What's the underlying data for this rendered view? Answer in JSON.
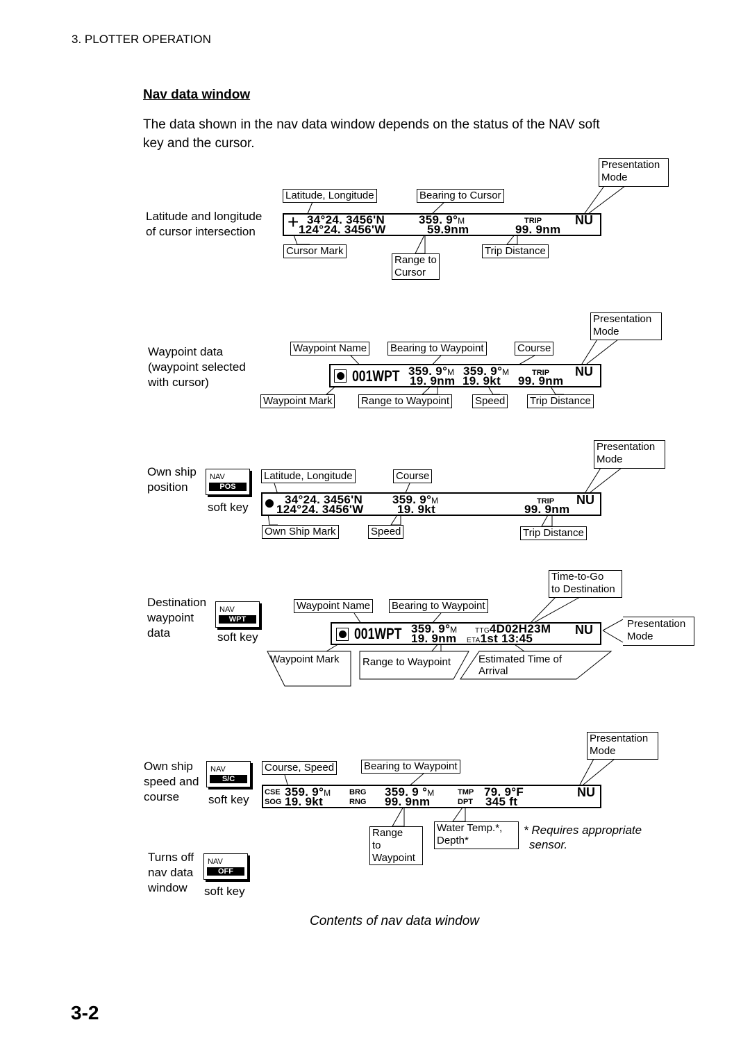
{
  "header": {
    "section": "3. PLOTTER OPERATION"
  },
  "heading": "Nav data window",
  "intro": [
    "The data shown in the nav data window depends on the status of the NAV soft",
    "key and the cursor."
  ],
  "presentation_mode": [
    "Presentation",
    "Mode"
  ],
  "soft_key": "soft key",
  "cursor": {
    "desc": [
      "Latitude and longitude",
      "of cursor intersection"
    ],
    "labels": {
      "latlon": "Latitude, Longitude",
      "bearing": "Bearing to Cursor",
      "mark": "Cursor Mark",
      "range": [
        "Range to",
        "Cursor"
      ],
      "trip": "Trip Distance"
    },
    "display": {
      "mark": "+",
      "lat": "34°24. 3456'N",
      "lon": "124°24. 3456'W",
      "bearing": "359. 9°",
      "bearing_unit": "M",
      "range": "59.9nm",
      "trip_label": "TRIP",
      "trip": "99. 9nm",
      "mode": "NU"
    }
  },
  "waypoint": {
    "desc": [
      "Waypoint data",
      "(waypoint selected",
      "with cursor)"
    ],
    "labels": {
      "name": "Waypoint Name",
      "bearing": "Bearing to Waypoint",
      "course": "Course",
      "mark": "Waypoint Mark",
      "range": "Range to Waypoint",
      "speed": "Speed",
      "trip": "Trip Distance"
    },
    "display": {
      "name": "001WPT",
      "bearing": "359. 9°",
      "bearing_unit": "M",
      "course": "359. 9°",
      "course_unit": "M",
      "range": "19. 9nm",
      "speed": "19. 9kt",
      "trip_label": "TRIP",
      "trip": "99. 9nm",
      "mode": "NU"
    }
  },
  "own_ship": {
    "desc": [
      "Own ship",
      "position"
    ],
    "key": {
      "top": "NAV",
      "bottom": "POS"
    },
    "labels": {
      "latlon": "Latitude, Longitude",
      "course": "Course",
      "mark": "Own Ship Mark",
      "speed": "Speed",
      "trip": "Trip Distance"
    },
    "display": {
      "lat": "34°24. 3456'N",
      "lon": "124°24. 3456'W",
      "course": "359. 9°",
      "course_unit": "M",
      "speed": "19. 9kt",
      "trip_label": "TRIP",
      "trip": "99. 9nm",
      "mode": "NU"
    }
  },
  "destination": {
    "desc": [
      "Destination",
      "waypoint",
      "data"
    ],
    "key": {
      "top": "NAV",
      "bottom": "WPT"
    },
    "labels": {
      "ttg": [
        "Time-to-Go",
        "to Destination"
      ],
      "name": "Waypoint Name",
      "bearing": "Bearing to Waypoint",
      "mark": "Waypoint Mark",
      "range": "Range to Waypoint",
      "eta": [
        "Estimated Time of",
        "Arrival"
      ]
    },
    "display": {
      "name": "001WPT",
      "bearing": "359. 9°",
      "bearing_unit": "M",
      "ttg_label": "TTG",
      "ttg": "4D02H23M",
      "range": "19. 9nm",
      "eta_label": "ETA",
      "eta": "1st 13:45",
      "mode": "NU"
    }
  },
  "speed_course": {
    "desc": [
      "Own ship",
      "speed and",
      "course"
    ],
    "key": {
      "top": "NAV",
      "bottom": "S/C"
    },
    "labels": {
      "cse_spd": "Course, Speed",
      "bearing": "Bearing to Waypoint",
      "range": [
        "Range",
        "to",
        "Waypoint"
      ],
      "temp": [
        "Water Temp.*,",
        "Depth*"
      ]
    },
    "display": {
      "cse_label": "CSE",
      "cse": "359. 9°",
      "cse_unit": "M",
      "sog_label": "SOG",
      "sog": "19. 9kt",
      "brg_label": "BRG",
      "brg": "359. 9 °",
      "brg_unit": "M",
      "rng_label": "RNG",
      "rng": "99. 9nm",
      "tmp_label": "TMP",
      "tmp": "79. 9°F",
      "dpt_label": "DPT",
      "dpt": "345 ft",
      "mode": "NU"
    },
    "footnote": [
      "* Requires appropriate",
      "sensor."
    ]
  },
  "off": {
    "desc": [
      "Turns off",
      "nav data",
      "window"
    ],
    "key": {
      "top": "NAV",
      "bottom": "OFF"
    }
  },
  "caption": "Contents of nav data window",
  "page_number": "3-2"
}
